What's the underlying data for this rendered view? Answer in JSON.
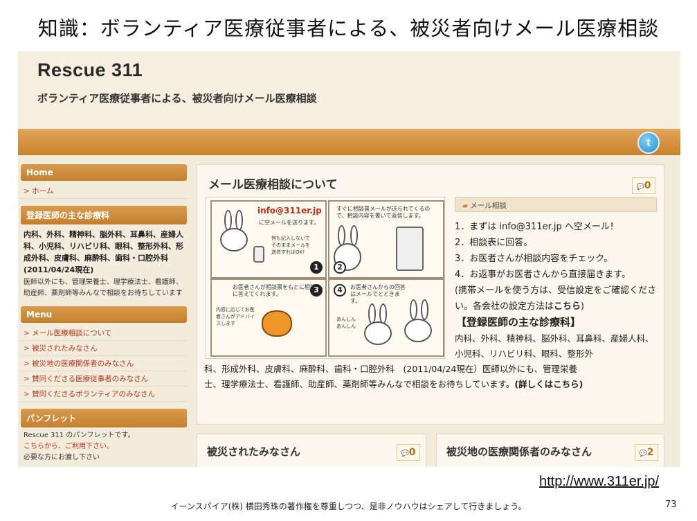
{
  "slide": {
    "title": "知識：ボランティア医療従事者による、被災者向けメール医療相談",
    "url": "http://www.311er.jp/",
    "footer": "イーンスパイア(株) 横田秀珠の著作権を尊重しつつ、是非ノウハウはシェアして行きましょう。",
    "page_number": "73"
  },
  "site": {
    "title": "Rescue 311",
    "subtitle": "ボランティア医療従事者による、被災者向けメール医療相談",
    "twitter_icon": "twitter-icon"
  },
  "sidebar": {
    "home_head": "Home",
    "home_link": "ホーム",
    "doctors_head": "登録医師の主な診療科",
    "doctors_bold": "内科、外科、精神科、脳外科、耳鼻科、産婦人科、小児科、リハビリ科、眼科、整形外科、形成外科、皮膚科、麻酔科、歯科・口腔外科　(2011/04/24現在)",
    "doctors_text": "医師以外にも、管理栄養士、理学療法士、看護師、助産師、薬剤師等みんなで相談をお待ちしています",
    "menu_head": "Menu",
    "menu_items": [
      "メール医療相談について",
      "被災されたみなさん",
      "被災地の医療関係者のみなさん",
      "賛同くださる医療従事者のみなさん",
      "賛同くださるボランティアのみなさん"
    ],
    "pamphlet_head": "パンフレット",
    "pamphlet_text": "Rescue 311 のパンフレットです。",
    "pamphlet_red": "こちらから、ご利用下さい。",
    "pamphlet_cut": "必要な方にお渡し下さい"
  },
  "main": {
    "title": "メール医療相談について",
    "comment_count": "0",
    "info_head": "メール相談",
    "comic": {
      "email": "info@311er.jp",
      "cap1": "に空メールを送ります。",
      "cap1b": "何も記入しないでそのままメールを送信すればOK！",
      "cap2": "すぐに相談票メールが送られてくるので、相談内容を書いて返信します。",
      "cap3": "お医者さんが相談票をもとに相談に答えてくれます。",
      "cap3b": "内容に応じてお医者さんがアドバイスします",
      "cap4": "お医者さんからの回答はメールでとどきます。",
      "cap4b": "あんしん あんしん",
      "n1": "1",
      "n2": "2",
      "n3": "3",
      "n4": "4"
    },
    "steps": [
      "1．まずは info@311er.jp へ空メール！",
      "2．相談表に回答。",
      "3．お医者さんが相談内容をチェック。",
      "4．お返事がお医者さんから直接届きます。"
    ],
    "mobile_note_a": "(携帯メールを使う方は、受信設定をご確認ください。各会社の設定方法は",
    "mobile_note_link": "こちら",
    "mobile_note_b": ")",
    "spec_head": "【登録医師の主な診療科】",
    "spec_line1": "内科、外科、精神科、脳外科、耳鼻科、産婦人科、小児科、リハビリ科、眼科、整形外",
    "spec_line2": "科、形成外科、皮膚科、麻酔科、歯科・口腔外科　(2011/04/24現在）医師以外にも、管理栄養",
    "spec_line3": "士、理学療法士、看護師、助産師、薬剤師等みんなで相談をお待ちしています。",
    "spec_link": "(詳しくはこちら)"
  },
  "bottom": {
    "left_title": "被災されたみなさん",
    "left_count": "0",
    "right_title": "被災地の医療関係者のみなさん",
    "right_count": "2"
  }
}
